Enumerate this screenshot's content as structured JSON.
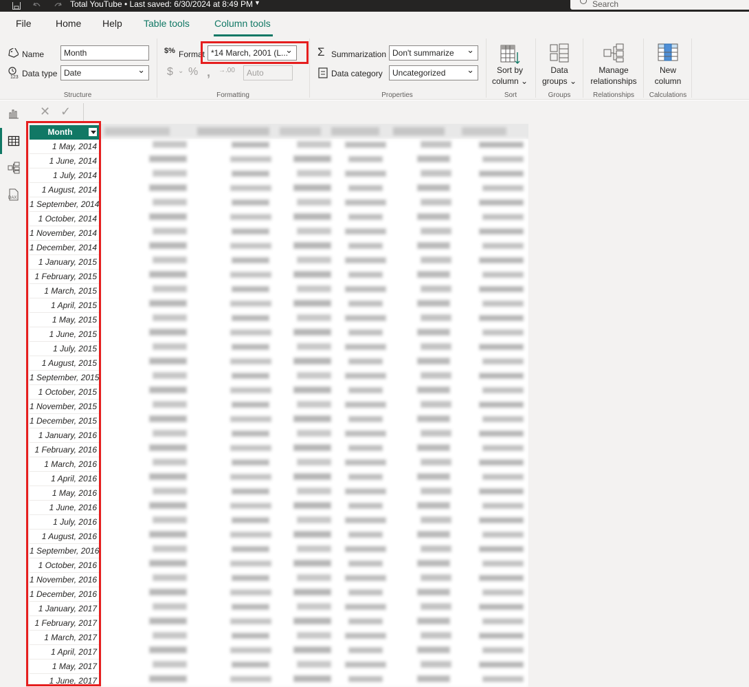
{
  "titlebar": {
    "title": "Total YouTube",
    "saved": "Last saved: 6/30/2024 at 8:49 PM",
    "search_placeholder": "Search"
  },
  "tabs": [
    "File",
    "Home",
    "Help",
    "Table tools",
    "Column tools"
  ],
  "ribbon": {
    "structure": {
      "name_label": "Name",
      "name_value": "Month",
      "datatype_label": "Data type",
      "datatype_value": "Date",
      "group": "Structure"
    },
    "formatting": {
      "format_label": "Format",
      "format_value": "*14 March, 2001 (L...",
      "auto_value": "Auto",
      "group": "Formatting"
    },
    "properties": {
      "summarization_label": "Summarization",
      "summarization_value": "Don't summarize",
      "category_label": "Data category",
      "category_value": "Uncategorized",
      "group": "Properties"
    },
    "sort": {
      "label1": "Sort by",
      "label2": "column",
      "group": "Sort"
    },
    "groups": {
      "label1": "Data",
      "label2": "groups",
      "group": "Groups"
    },
    "relationships": {
      "label1": "Manage",
      "label2": "relationships",
      "group": "Relationships"
    },
    "calculations": {
      "label1": "New",
      "label2": "column",
      "group": "Calculations"
    }
  },
  "table": {
    "column_header": "Month",
    "rows": [
      "1 May, 2014",
      "1 June, 2014",
      "1 July, 2014",
      "1 August, 2014",
      "1 September, 2014",
      "1 October, 2014",
      "1 November, 2014",
      "1 December, 2014",
      "1 January, 2015",
      "1 February, 2015",
      "1 March, 2015",
      "1 April, 2015",
      "1 May, 2015",
      "1 June, 2015",
      "1 July, 2015",
      "1 August, 2015",
      "1 September, 2015",
      "1 October, 2015",
      "1 November, 2015",
      "1 December, 2015",
      "1 January, 2016",
      "1 February, 2016",
      "1 March, 2016",
      "1 April, 2016",
      "1 May, 2016",
      "1 June, 2016",
      "1 July, 2016",
      "1 August, 2016",
      "1 September, 2016",
      "1 October, 2016",
      "1 November, 2016",
      "1 December, 2016",
      "1 January, 2017",
      "1 February, 2017",
      "1 March, 2017",
      "1 April, 2017",
      "1 May, 2017",
      "1 June, 2017"
    ]
  },
  "colors": {
    "accent": "#117865",
    "highlight": "#e51e1e"
  }
}
